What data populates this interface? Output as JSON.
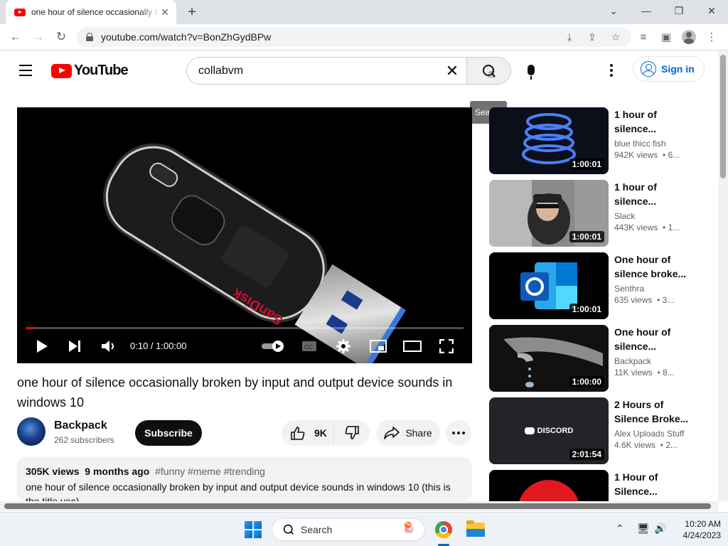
{
  "browser": {
    "tab_title": "one hour of silence occasionally broken by input and output device sounds in windows 10 - YouTube",
    "url": "youtube.com/watch?v=BonZhGydBPw",
    "new_tab": "+",
    "window_controls": {
      "dropdown": "⌄",
      "minimize": "—",
      "restore": "❐",
      "close": "✕"
    }
  },
  "youtube": {
    "logo_text": "YouTube",
    "search_query": "collabvm",
    "search_tooltip": "Search",
    "signin_label": "Sign in"
  },
  "player": {
    "time": "0:10 / 1:00:00",
    "progress": 0.0028,
    "brand_text": "SanDisk"
  },
  "video": {
    "title": "one hour of silence occasionally broken by input and output device sounds in windows 10",
    "channel": "Backpack",
    "subscribers": "262 subscribers",
    "subscribe_label": "Subscribe",
    "likes": "9K",
    "share_label": "Share",
    "views": "305K views",
    "age": "9 months ago",
    "hashtags": "#funny #meme #trending",
    "description": "one hour of silence occasionally broken by input and output device sounds in windows 10 (this is the title yes)"
  },
  "recommendations": [
    {
      "title": "1 hour of silence...",
      "channel": "blue thicc fish",
      "views": "942K views",
      "age": "• 6...",
      "duration": "1:00:01"
    },
    {
      "title": "1 hour of silence...",
      "channel": "Slack",
      "views": "443K views",
      "age": "• 1...",
      "duration": "1:00:01"
    },
    {
      "title": "One hour of silence broke...",
      "channel": "Senthra",
      "views": "635 views",
      "age": "• 3...",
      "duration": "1:00:01"
    },
    {
      "title": "One hour of silence...",
      "channel": "Backpack",
      "views": "11K views",
      "age": "• 8...",
      "duration": "1:00:00"
    },
    {
      "title": "2 Hours of Silence Broke...",
      "channel": "Alex Uploads Stuff",
      "views": "4.6K views",
      "age": "• 2...",
      "duration": "2:01:54",
      "thumb_text": "DISCORD"
    },
    {
      "title": "1 Hour of Silence..."
    }
  ],
  "taskbar": {
    "search_placeholder": "Search",
    "time": "10:20 AM",
    "date": "4/24/2023"
  }
}
